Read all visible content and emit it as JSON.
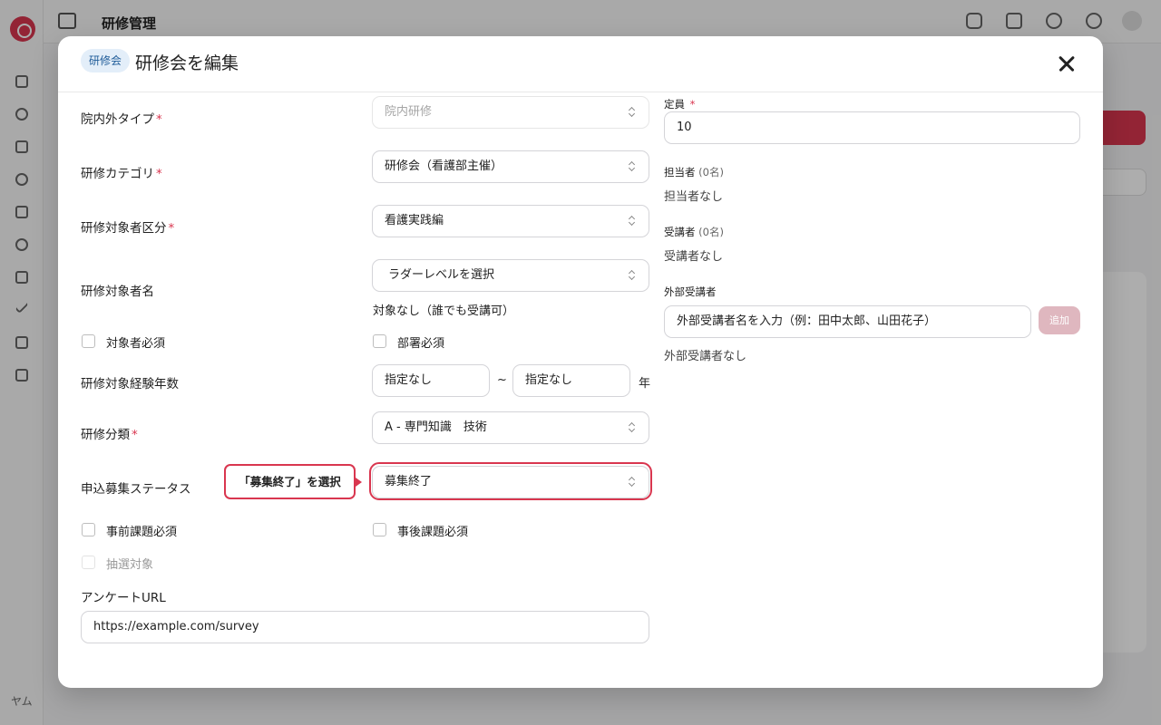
{
  "background": {
    "header_title": "研修管理",
    "sidebar_footer": "ヤム"
  },
  "modal": {
    "badge": "研修会",
    "title": "研修会を編集"
  },
  "form": {
    "internal_type": {
      "label": "院内外タイプ",
      "required": "*",
      "value": "院内研修"
    },
    "category": {
      "label": "研修カテゴリ",
      "required": "*",
      "value": "研修会（看護部主催）"
    },
    "target_class": {
      "label": "研修対象者区分",
      "required": "*",
      "value": "看護実践編"
    },
    "target_name": {
      "label": "研修対象者名",
      "value": "ラダーレベルを選択",
      "note": "対象なし（誰でも受講可）"
    },
    "target_required_label": "対象者必須",
    "dept_required_label": "部署必須",
    "experience": {
      "label": "研修対象経験年数",
      "from": "指定なし",
      "tilde": "~",
      "to": "指定なし",
      "unit": "年"
    },
    "classification": {
      "label": "研修分類",
      "required": "*",
      "value": "A - 専門知識　技術"
    },
    "status": {
      "label": "申込募集ステータス",
      "value": "募集終了"
    },
    "pre_task_label": "事前課題必須",
    "post_task_label": "事後課題必須",
    "lottery_label": "抽選対象",
    "survey": {
      "label": "アンケートURL",
      "value": "https://example.com/survey"
    }
  },
  "right": {
    "capacity": {
      "label": "定員",
      "required": "*",
      "value": "10"
    },
    "staff": {
      "label": "担当者",
      "count": "(0名)",
      "empty": "担当者なし"
    },
    "attendees": {
      "label": "受講者",
      "count": "(0名)",
      "empty": "受講者なし"
    },
    "external": {
      "label": "外部受講者",
      "placeholder": "外部受講者名を入力（例：田中太郎、山田花子）",
      "add": "追加",
      "empty": "外部受講者なし"
    }
  },
  "callout": {
    "text": "「募集終了」を選択"
  },
  "colors": {
    "accent": "#d9364f",
    "badge_bg": "#e3eef9",
    "badge_text": "#1f5c99",
    "add_disabled": "#dfb7bf"
  }
}
